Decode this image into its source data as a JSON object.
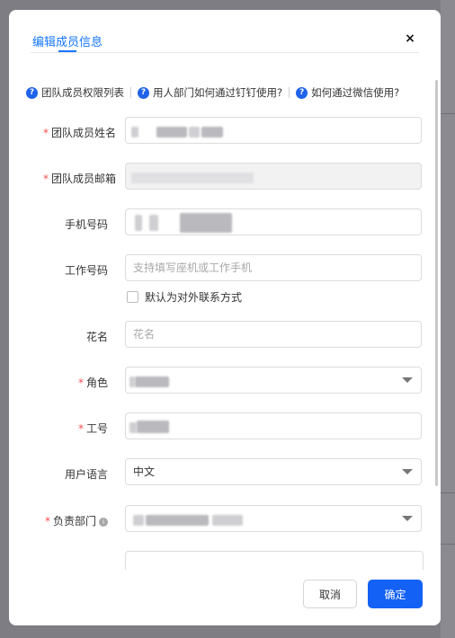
{
  "modal": {
    "title": "编辑成员信息",
    "close_label": "×"
  },
  "help_links": [
    {
      "label": "团队成员权限列表"
    },
    {
      "label": "用人部门如何通过钉钉使用?"
    },
    {
      "label": "如何通过微信使用?"
    }
  ],
  "fields": {
    "name": {
      "label": "团队成员姓名",
      "required": true
    },
    "email": {
      "label": "团队成员邮箱",
      "required": true
    },
    "mobile": {
      "label": "手机号码",
      "required": false
    },
    "work_phone": {
      "label": "工作号码",
      "placeholder": "支持填写座机或工作手机",
      "required": false
    },
    "default_contact": {
      "label": "默认为对外联系方式",
      "checked": false
    },
    "nickname": {
      "label": "花名",
      "placeholder": "花名",
      "required": false
    },
    "role": {
      "label": "角色",
      "required": true
    },
    "employee_id": {
      "label": "工号",
      "required": true
    },
    "language": {
      "label": "用户语言",
      "value": "中文",
      "required": false
    },
    "department": {
      "label": "负责部门",
      "required": true
    }
  },
  "footer": {
    "cancel_label": "取消",
    "ok_label": "确定"
  },
  "colors": {
    "accent": "#1677ff",
    "primary_button": "#1461f5",
    "required_mark": "#ff4d4f"
  },
  "icons": {
    "help": "question-circle-icon",
    "info": "info-circle-icon",
    "close": "close-icon",
    "dropdown": "caret-down-icon"
  }
}
